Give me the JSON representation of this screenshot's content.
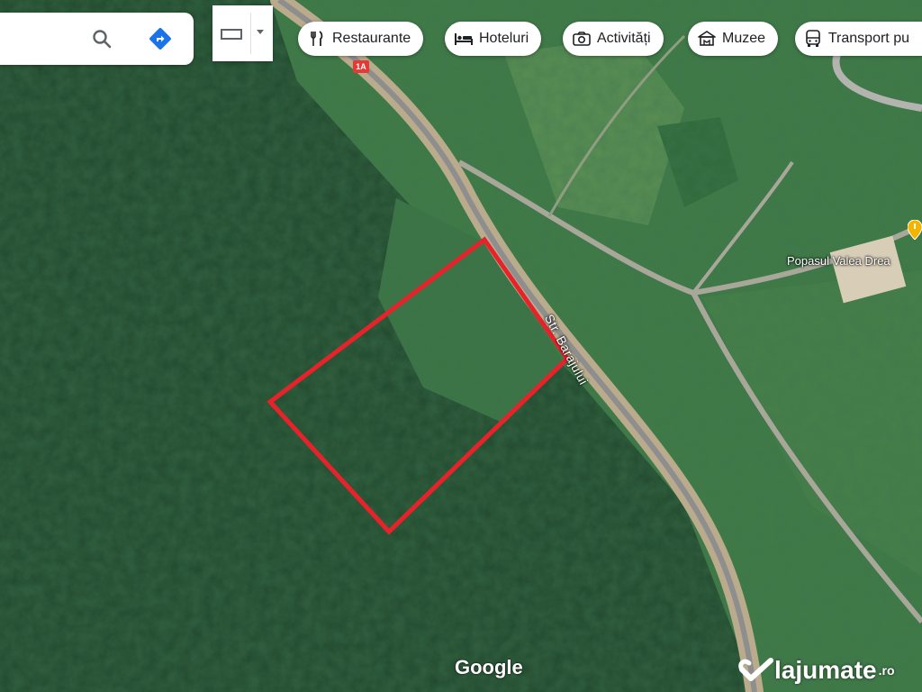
{
  "search": {
    "search_icon": "search-icon",
    "directions_icon": "directions-icon",
    "directions_color": "#1a73e8"
  },
  "map_type": {
    "icon": "map-layer-icon",
    "dropdown_icon": "chevron-down-icon"
  },
  "chips": [
    {
      "label": "Restaurante",
      "icon": "fork-knife-icon"
    },
    {
      "label": "Hoteluri",
      "icon": "bed-icon"
    },
    {
      "label": "Activități",
      "icon": "camera-icon"
    },
    {
      "label": "Muzee",
      "icon": "museum-icon"
    },
    {
      "label": "Transport pu",
      "icon": "bus-icon"
    }
  ],
  "map": {
    "road_label": "Str. Barajului",
    "route_badge": "1A",
    "place_label": "Popasul Valea Drea",
    "poi_color": "#f4b400",
    "highlight_color": "#e8222a",
    "attribution": "Google"
  },
  "watermark": {
    "name": "lajumate",
    "tld": ".ro"
  }
}
